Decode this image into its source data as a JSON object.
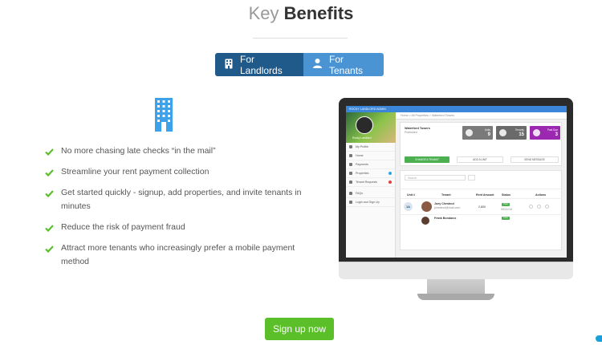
{
  "heading": {
    "light": "Key",
    "strong": "Benefits"
  },
  "tabs": [
    {
      "label": "For Landlords",
      "icon": "building-icon",
      "active": true
    },
    {
      "label": "For Tenants",
      "icon": "person-icon",
      "active": false
    }
  ],
  "benefits": [
    "No more chasing late checks “in the mail”",
    "Streamline your rent payment collection",
    "Get started quickly - signup, add properties, and invite tenants in minutes",
    "Reduce the risk of payment fraud",
    "Attract more tenants who increasingly prefer a mobile payment method"
  ],
  "screen": {
    "topbar": "ROCKY LANDLORD ADMIN",
    "breadcrumb": "Home  >  All Properties  >  Waterford Towers",
    "sidebar": {
      "user": "Rocky Landlord",
      "items": [
        {
          "label": "My Profile",
          "badge": ""
        },
        {
          "label": "Home",
          "badge": ""
        },
        {
          "label": "Payments",
          "badge": ""
        },
        {
          "label": "Properties",
          "badge": "#2ca7e0"
        },
        {
          "label": "Tenant Requests",
          "badge": "#e04040"
        },
        {
          "label": "FAQs",
          "badge": ""
        },
        {
          "label": "Login and Sign Up",
          "badge": ""
        }
      ]
    },
    "property": {
      "name": "Waterford Towers",
      "status": "Published"
    },
    "stats": [
      {
        "label": "Units",
        "value": "9",
        "color": "#7a7a7a"
      },
      {
        "label": "Tenants",
        "value": "15",
        "color": "#6a6a6a"
      },
      {
        "label": "Past Due",
        "value": "3",
        "color": "#9c27b0"
      }
    ],
    "buttons": {
      "change": "CHANGE A TENANT",
      "add": "ADD A UNIT",
      "message": "SEND MESSAGE"
    },
    "search_placeholder": "Search",
    "table_headers": [
      "Unit #",
      "Tenant",
      "Rent Amount",
      "Status",
      "Actions"
    ],
    "rows": [
      {
        "unit": "1A",
        "tenant": "Joey Chestnut",
        "email": "jchestnut@mail.com",
        "rent": "2,800",
        "status": "Paid",
        "date": "05/31/16"
      },
      {
        "unit": "",
        "tenant": "Frank Bondarcx",
        "email": "",
        "rent": "",
        "status": "Paid",
        "date": ""
      }
    ]
  },
  "cta": "Sign up now",
  "colors": {
    "tab_active": "#1f5a8a",
    "tab_inactive": "#4a94d4",
    "check": "#5bbf2a",
    "cta": "#5bbf2a",
    "building": "#3ea2ea"
  }
}
